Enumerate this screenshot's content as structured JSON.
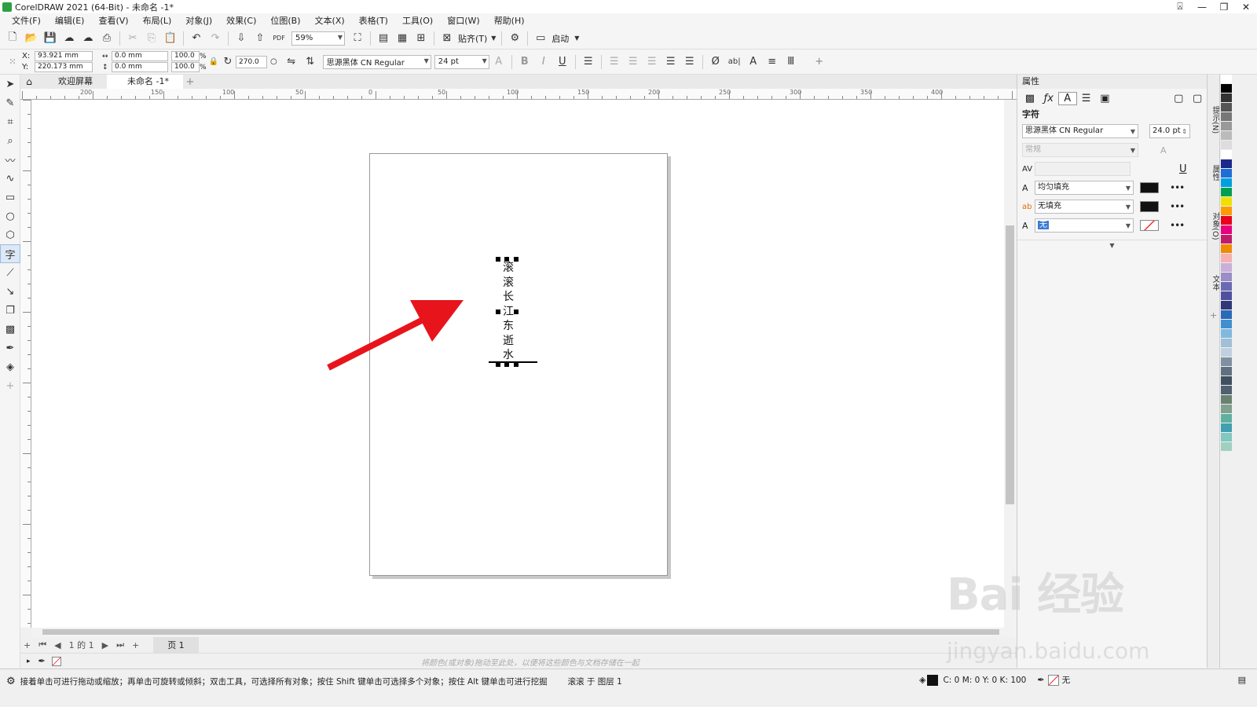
{
  "window": {
    "title": "CorelDRAW 2021 (64-Bit) - 未命名 -1*"
  },
  "menu": [
    "文件(F)",
    "编辑(E)",
    "查看(V)",
    "布局(L)",
    "对象(J)",
    "效果(C)",
    "位图(B)",
    "文本(X)",
    "表格(T)",
    "工具(O)",
    "窗口(W)",
    "帮助(H)"
  ],
  "toolbar": {
    "zoom": "59%",
    "snap_label": "贴齐(T)",
    "launch_label": "启动"
  },
  "propbar": {
    "x_label": "X:",
    "y_label": "Y:",
    "x_value": "93.921 mm",
    "y_value": "220.173 mm",
    "w_value": "0.0 mm",
    "h_value": "0.0 mm",
    "scale_w": "100.0",
    "scale_h": "100.0",
    "percent": "%",
    "rotation": "270.0",
    "font": "思源黑体 CN Regular",
    "font_size": "24 pt"
  },
  "doctabs": {
    "welcome": "欢迎屏幕",
    "document": "未命名 -1*"
  },
  "ruler_labels": [
    "200",
    "150",
    "100",
    "50",
    "0",
    "50",
    "100",
    "150",
    "200",
    "250",
    "300",
    "350",
    "400"
  ],
  "canvas_text": [
    "滚",
    "滚",
    "长",
    "江",
    "东",
    "逝",
    "水"
  ],
  "pagenav": {
    "page_count": "1 的 1",
    "page_tab": "页 1"
  },
  "palette_hint": "将颜色(或对象)拖动至此处，以便将这些颜色与文档存储在一起",
  "status": {
    "hint": "接着单击可进行拖动或缩放；再单击可旋转或倾斜；双击工具，可选择所有对象；按住 Shift 键单击可选择多个对象；按住 Alt 键单击可进行挖掘",
    "selection": "滚滚 于 图层 1",
    "fill_cmyk": "C: 0 M: 0 Y: 0 K: 100",
    "outline": "无"
  },
  "docker": {
    "title": "属性",
    "section": "字符",
    "font": "思源黑体 CN Regular",
    "font_size": "24.0 pt",
    "style": "常规",
    "fill1": "均匀填充",
    "fill2": "无填充",
    "outline": "无"
  },
  "sidetabs": [
    "提示(N)",
    "属性",
    "对象(O)",
    "文本"
  ],
  "watermark": {
    "brand": "Bai 经验",
    "url": "jingyan.baidu.com"
  },
  "colors": {
    "palette": [
      "#ffffff",
      "#000000",
      "#333333",
      "#555555",
      "#777777",
      "#999999",
      "#bbbbbb",
      "#dddddd",
      "#ffffff",
      "#1a2a8a",
      "#1e6ed8",
      "#00a0e0",
      "#00a050",
      "#f0e000",
      "#ff9900",
      "#e8001c",
      "#e6007e",
      "#c01a6a",
      "#f08a00",
      "#f5b0b0",
      "#c8b0d8",
      "#9c8cc8",
      "#6a6ab4",
      "#5050a0",
      "#303878",
      "#2a6ab8",
      "#4090d0",
      "#80b8e0",
      "#a0c0d8",
      "#c0d0e0",
      "#8090a0",
      "#607080",
      "#405060",
      "#506070",
      "#6a8070",
      "#80a090",
      "#60b0a0",
      "#40a0b0",
      "#80c8c0",
      "#a0d0c0"
    ],
    "arrow": "#e8141c"
  }
}
